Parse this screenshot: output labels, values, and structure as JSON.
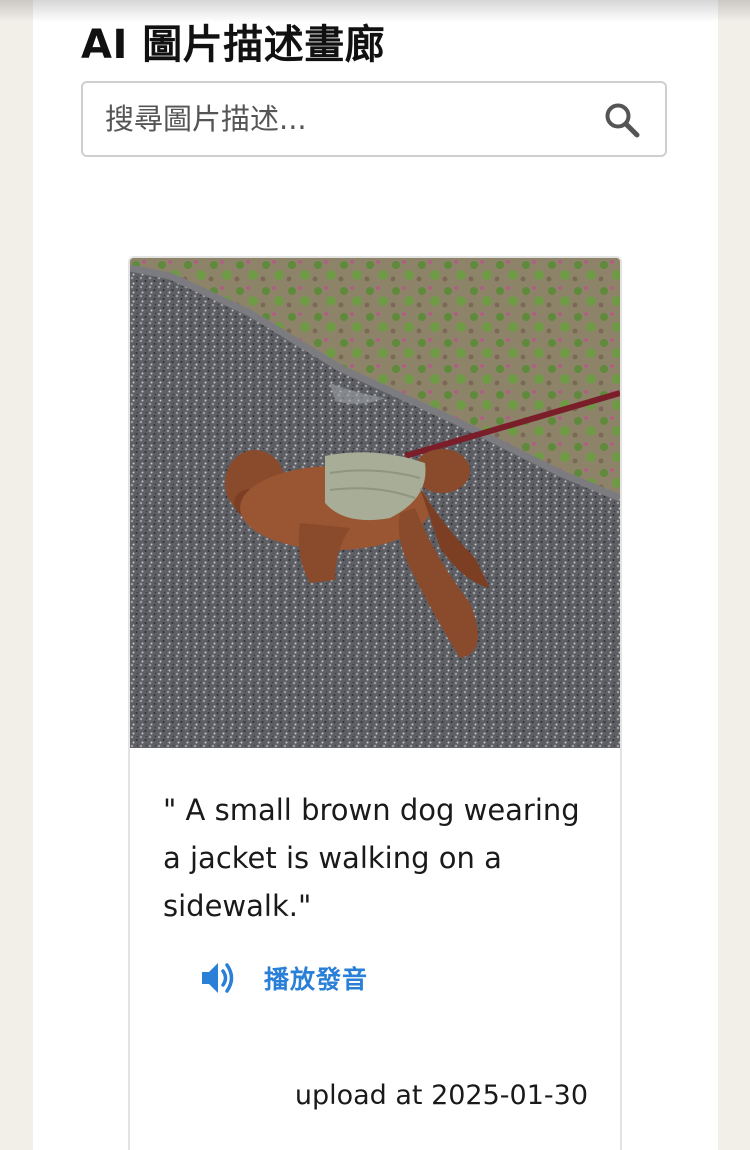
{
  "header": {
    "title": "AI 圖片描述畫廊"
  },
  "search": {
    "placeholder": "搜尋圖片描述...",
    "value": "",
    "icon": "search-icon"
  },
  "card": {
    "image_alt": "small brown dog in a jacket on a leash",
    "caption": "\" A small brown dog wearing a jacket is walking on a sidewalk.\"",
    "play_icon": "speaker-icon",
    "play_label": "播放發音",
    "upload_text": "upload at 2025-01-30"
  },
  "colors": {
    "accent": "#2a7fd6",
    "page_background": "#ffffff",
    "outer_background": "#f2efe9",
    "text": "#1a1a1a",
    "border": "#cfcfcf"
  }
}
